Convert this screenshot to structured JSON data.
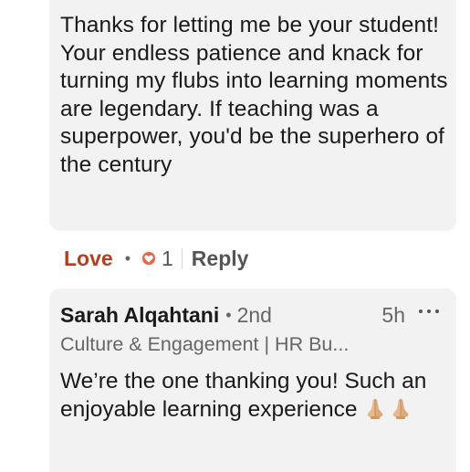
{
  "comment_1": {
    "text": "Thanks for letting me be your student! Your endless patience and knack for turning my flubs into learning moments are legendary. If teaching was a superpower, you'd be the superhero of the century"
  },
  "actions": {
    "love_label": "Love",
    "separator_dot": "•",
    "reaction_count": "1",
    "reply_label": "Reply",
    "reaction_icon": "heart-icon",
    "love_color": "#b24020"
  },
  "comment_2": {
    "author": "Sarah Alqahtani",
    "dot": "•",
    "degree": "2nd",
    "time": "5h",
    "headline": "Culture & Engagement | HR Bu...",
    "text": "We’re the one thanking you! Such an enjoyable learning experience",
    "emoji": "folded-hands-icon"
  },
  "colors": {
    "bubble_bg": "#f2f2f2",
    "text_primary": "#1a1a1a",
    "text_secondary": "#666666",
    "reaction_badge": "#e06847"
  }
}
